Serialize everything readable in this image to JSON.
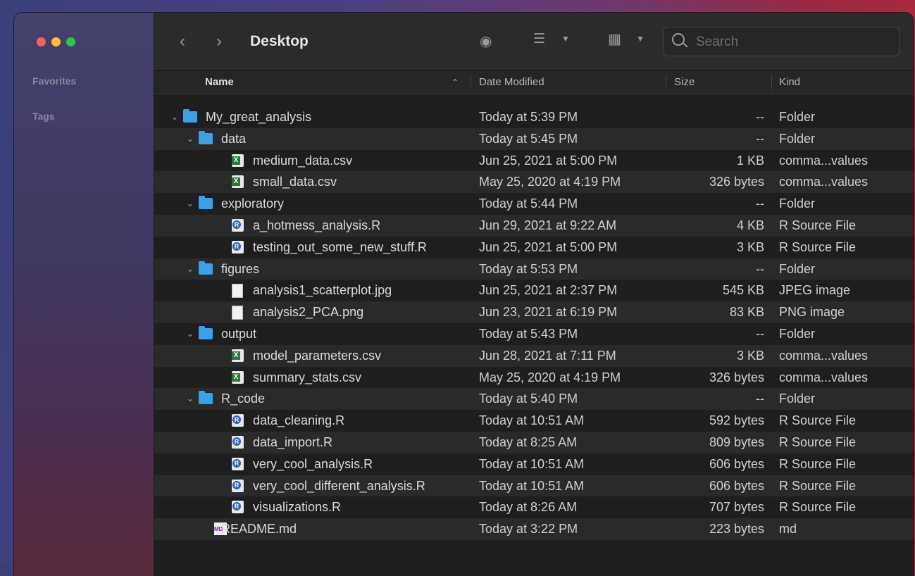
{
  "sidebar": {
    "favorites_label": "Favorites",
    "tags_label": "Tags"
  },
  "toolbar": {
    "title": "Desktop",
    "search_placeholder": "Search"
  },
  "columns": {
    "name": "Name",
    "date": "Date Modified",
    "size": "Size",
    "kind": "Kind"
  },
  "colors": {
    "folder": "#3aa0e8",
    "close": "#fe5f57",
    "minimize": "#febc2e",
    "maximize": "#28c840"
  },
  "rows": [
    {
      "name": "My_great_analysis",
      "date": "Today at 5:39 PM",
      "size": "--",
      "kind": "Folder",
      "icon": "folder-icon",
      "depth": 0,
      "expanded": true
    },
    {
      "name": "data",
      "date": "Today at 5:45 PM",
      "size": "--",
      "kind": "Folder",
      "icon": "folder-icon",
      "depth": 1,
      "expanded": true
    },
    {
      "name": "medium_data.csv",
      "date": "Jun 25, 2021 at 5:00 PM",
      "size": "1 KB",
      "kind": "comma...values",
      "icon": "csv-file-icon",
      "depth": 2
    },
    {
      "name": "small_data.csv",
      "date": "May 25, 2020 at 4:19 PM",
      "size": "326 bytes",
      "kind": "comma...values",
      "icon": "csv-file-icon",
      "depth": 2
    },
    {
      "name": "exploratory",
      "date": "Today at 5:44 PM",
      "size": "--",
      "kind": "Folder",
      "icon": "folder-icon",
      "depth": 1,
      "expanded": true
    },
    {
      "name": "a_hotmess_analysis.R",
      "date": "Jun 29, 2021 at 9:22 AM",
      "size": "4 KB",
      "kind": "R Source File",
      "icon": "r-file-icon",
      "depth": 2
    },
    {
      "name": "testing_out_some_new_stuff.R",
      "date": "Jun 25, 2021 at 5:00 PM",
      "size": "3 KB",
      "kind": "R Source File",
      "icon": "r-file-icon",
      "depth": 2
    },
    {
      "name": "figures",
      "date": "Today at 5:53 PM",
      "size": "--",
      "kind": "Folder",
      "icon": "folder-icon",
      "depth": 1,
      "expanded": true
    },
    {
      "name": "analysis1_scatterplot.jpg",
      "date": "Jun 25, 2021 at 2:37 PM",
      "size": "545 KB",
      "kind": "JPEG image",
      "icon": "image-file-icon",
      "depth": 2
    },
    {
      "name": "analysis2_PCA.png",
      "date": "Jun 23, 2021 at 6:19 PM",
      "size": "83 KB",
      "kind": "PNG image",
      "icon": "image-file-icon",
      "depth": 2
    },
    {
      "name": "output",
      "date": "Today at 5:43 PM",
      "size": "--",
      "kind": "Folder",
      "icon": "folder-icon",
      "depth": 1,
      "expanded": true
    },
    {
      "name": "model_parameters.csv",
      "date": "Jun 28, 2021 at 7:11 PM",
      "size": "3 KB",
      "kind": "comma...values",
      "icon": "csv-file-icon",
      "depth": 2
    },
    {
      "name": "summary_stats.csv",
      "date": "May 25, 2020 at 4:19 PM",
      "size": "326 bytes",
      "kind": "comma...values",
      "icon": "csv-file-icon",
      "depth": 2
    },
    {
      "name": "R_code",
      "date": "Today at 5:40 PM",
      "size": "--",
      "kind": "Folder",
      "icon": "folder-icon",
      "depth": 1,
      "expanded": true
    },
    {
      "name": "data_cleaning.R",
      "date": "Today at 10:51 AM",
      "size": "592 bytes",
      "kind": "R Source File",
      "icon": "r-file-icon",
      "depth": 2
    },
    {
      "name": "data_import.R",
      "date": "Today at 8:25 AM",
      "size": "809 bytes",
      "kind": "R Source File",
      "icon": "r-file-icon",
      "depth": 2
    },
    {
      "name": "very_cool_analysis.R",
      "date": "Today at 10:51 AM",
      "size": "606 bytes",
      "kind": "R Source File",
      "icon": "r-file-icon",
      "depth": 2
    },
    {
      "name": "very_cool_different_analysis.R",
      "date": "Today at 10:51 AM",
      "size": "606 bytes",
      "kind": "R Source File",
      "icon": "r-file-icon",
      "depth": 2
    },
    {
      "name": "visualizations.R",
      "date": "Today at 8:26 AM",
      "size": "707 bytes",
      "kind": "R Source File",
      "icon": "r-file-icon",
      "depth": 2
    },
    {
      "name": "README.md",
      "date": "Today at 3:22 PM",
      "size": "223 bytes",
      "kind": "md",
      "icon": "markdown-file-icon",
      "depth": 1
    }
  ]
}
